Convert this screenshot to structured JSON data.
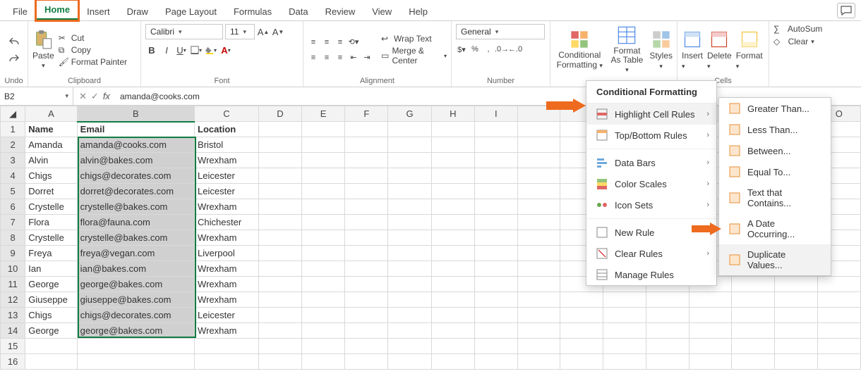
{
  "tabs": [
    "File",
    "Home",
    "Insert",
    "Draw",
    "Page Layout",
    "Formulas",
    "Data",
    "Review",
    "View",
    "Help"
  ],
  "ribbon": {
    "undo": "Undo",
    "clipboard": {
      "label": "Clipboard",
      "paste": "Paste",
      "cut": "Cut",
      "copy": "Copy",
      "painter": "Format Painter"
    },
    "font": {
      "label": "Font",
      "family": "Calibri",
      "size": "11"
    },
    "alignment": {
      "label": "Alignment",
      "wrap": "Wrap Text",
      "merge": "Merge & Center"
    },
    "number": {
      "label": "Number",
      "format": "General"
    },
    "styles_group": {
      "cond": "Conditional Formatting",
      "fastable": "Format As Table",
      "styles": "Styles"
    },
    "cells": {
      "label": "Cells",
      "insert": "Insert",
      "delete": "Delete",
      "format": "Format"
    },
    "editing": {
      "autosum": "AutoSum",
      "clear": "Clear"
    }
  },
  "fbar": {
    "ref": "B2",
    "formula": "amanda@cooks.com",
    "fx": "fx"
  },
  "columns": [
    "A",
    "B",
    "C",
    "D",
    "E",
    "F",
    "G",
    "H",
    "I",
    "",
    "",
    "",
    "",
    "",
    "",
    "",
    "O"
  ],
  "headers": {
    "name": "Name",
    "email": "Email",
    "location": "Location"
  },
  "rows": [
    {
      "n": "Amanda",
      "e": "amanda@cooks.com",
      "l": "Bristol"
    },
    {
      "n": "Alvin",
      "e": "alvin@bakes.com",
      "l": "Wrexham"
    },
    {
      "n": "Chigs",
      "e": "chigs@decorates.com",
      "l": "Leicester"
    },
    {
      "n": "Dorret",
      "e": "dorret@decorates.com",
      "l": "Leicester"
    },
    {
      "n": "Crystelle",
      "e": "crystelle@bakes.com",
      "l": "Wrexham"
    },
    {
      "n": "Flora",
      "e": "flora@fauna.com",
      "l": "Chichester"
    },
    {
      "n": "Crystelle",
      "e": "crystelle@bakes.com",
      "l": "Wrexham"
    },
    {
      "n": "Freya",
      "e": "freya@vegan.com",
      "l": "Liverpool"
    },
    {
      "n": "Ian",
      "e": "ian@bakes.com",
      "l": "Wrexham"
    },
    {
      "n": "George",
      "e": "george@bakes.com",
      "l": "Wrexham"
    },
    {
      "n": "Giuseppe",
      "e": "giuseppe@bakes.com",
      "l": "Wrexham"
    },
    {
      "n": "Chigs",
      "e": "chigs@decorates.com",
      "l": "Leicester"
    },
    {
      "n": "George",
      "e": "george@bakes.com",
      "l": "Wrexham"
    }
  ],
  "cf_menu": {
    "title": "Conditional Formatting",
    "items": [
      "Highlight Cell Rules",
      "Top/Bottom Rules",
      "Data Bars",
      "Color Scales",
      "Icon Sets",
      "New Rule",
      "Clear Rules",
      "Manage Rules"
    ]
  },
  "hcr_menu": [
    "Greater Than...",
    "Less Than...",
    "Between...",
    "Equal To...",
    "Text that Contains...",
    "A Date Occurring...",
    "Duplicate Values..."
  ]
}
